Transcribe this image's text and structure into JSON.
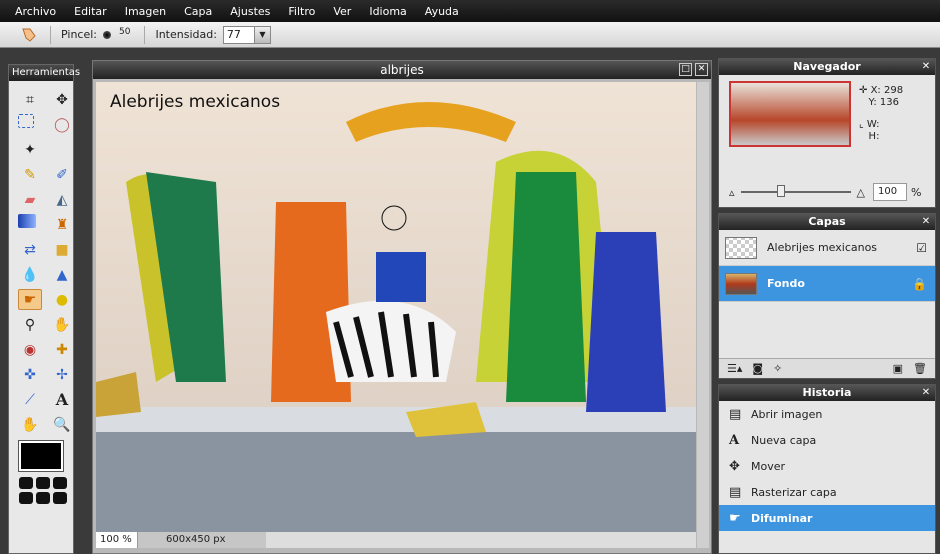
{
  "menu": [
    "Archivo",
    "Editar",
    "Imagen",
    "Capa",
    "Ajustes",
    "Filtro",
    "Ver",
    "Idioma",
    "Ayuda"
  ],
  "options": {
    "brush_label": "Pincel:",
    "brush_size": "50",
    "intensity_label": "Intensidad:",
    "intensity_value": "77"
  },
  "tools": {
    "title": "Herramientas"
  },
  "document": {
    "title": "albrijes",
    "overlay_text": "Alebrijes mexicanos",
    "zoom": "100 %",
    "size": "600x450 px"
  },
  "navigator": {
    "title": "Navegador",
    "x_label": "X:",
    "x_value": "298",
    "y_label": "Y:",
    "y_value": "136",
    "w_label": "W:",
    "h_label": "H:",
    "zoom": "100",
    "zoom_unit": "%"
  },
  "layers": {
    "title": "Capas",
    "items": [
      {
        "name": "Alebrijes mexicanos"
      },
      {
        "name": "Fondo"
      }
    ]
  },
  "history": {
    "title": "Historia",
    "items": [
      "Abrir imagen",
      "Nueva capa",
      "Mover",
      "Rasterizar capa",
      "Difuminar"
    ]
  }
}
